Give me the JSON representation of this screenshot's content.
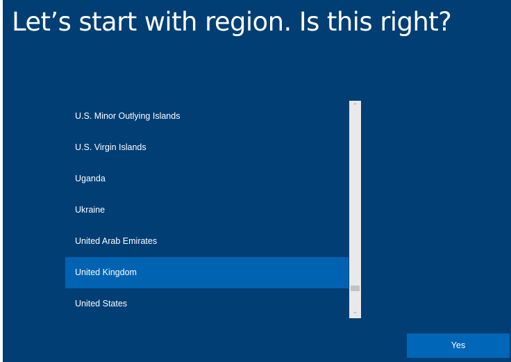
{
  "title": "Let’s start with region. Is this right?",
  "region_list": {
    "items": [
      {
        "label": "U.S. Minor Outlying Islands",
        "selected": false
      },
      {
        "label": "U.S. Virgin Islands",
        "selected": false
      },
      {
        "label": "Uganda",
        "selected": false
      },
      {
        "label": "Ukraine",
        "selected": false
      },
      {
        "label": "United Arab Emirates",
        "selected": false
      },
      {
        "label": "United Kingdom",
        "selected": true
      },
      {
        "label": "United States",
        "selected": false
      }
    ],
    "scroll_position": 0.92,
    "scroll_up_icon": "chevron-up-icon",
    "scroll_down_icon": "chevron-down-icon"
  },
  "yes_button": {
    "label": "Yes"
  },
  "colors": {
    "background": "#003e73",
    "selected_item": "#0063b1",
    "button": "#0067b8",
    "text": "#ffffff"
  }
}
